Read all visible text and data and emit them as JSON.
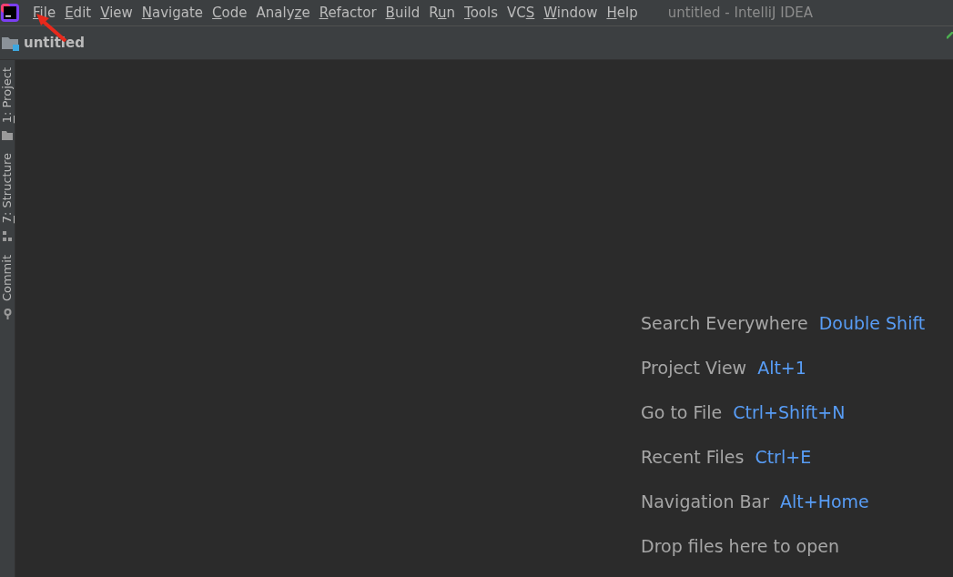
{
  "menu": [
    {
      "key": "F",
      "after": "ile"
    },
    {
      "key": "E",
      "after": "dit"
    },
    {
      "key": "V",
      "after": "iew"
    },
    {
      "key": "N",
      "after": "avigate"
    },
    {
      "key": "C",
      "after": "ode"
    },
    {
      "before": "Analy",
      "key": "z",
      "after": "e"
    },
    {
      "key": "R",
      "after": "efactor"
    },
    {
      "key": "B",
      "after": "uild"
    },
    {
      "before": "R",
      "key": "u",
      "after": "n"
    },
    {
      "key": "T",
      "after": "ools"
    },
    {
      "before": "VC",
      "key": "S"
    },
    {
      "key": "W",
      "after": "indow"
    },
    {
      "key": "H",
      "after": "elp"
    }
  ],
  "window": {
    "title": "untitled - IntelliJ IDEA"
  },
  "navigation_bar": {
    "project": "untitled"
  },
  "tool_window_tabs": [
    {
      "kind": "project",
      "key": "1",
      "after": ": Project"
    },
    {
      "kind": "structure",
      "key": "7",
      "after": ": Structure"
    },
    {
      "kind": "commit",
      "before": "Commit"
    }
  ],
  "hints": [
    {
      "label": "Search Everywhere",
      "shortcut": "Double Shift"
    },
    {
      "label": "Project View",
      "shortcut": "Alt+1"
    },
    {
      "label": "Go to File",
      "shortcut": "Ctrl+Shift+N"
    },
    {
      "label": "Recent Files",
      "shortcut": "Ctrl+E"
    },
    {
      "label": "Navigation Bar",
      "shortcut": "Alt+Home"
    },
    {
      "label": "Drop files here to open"
    }
  ]
}
